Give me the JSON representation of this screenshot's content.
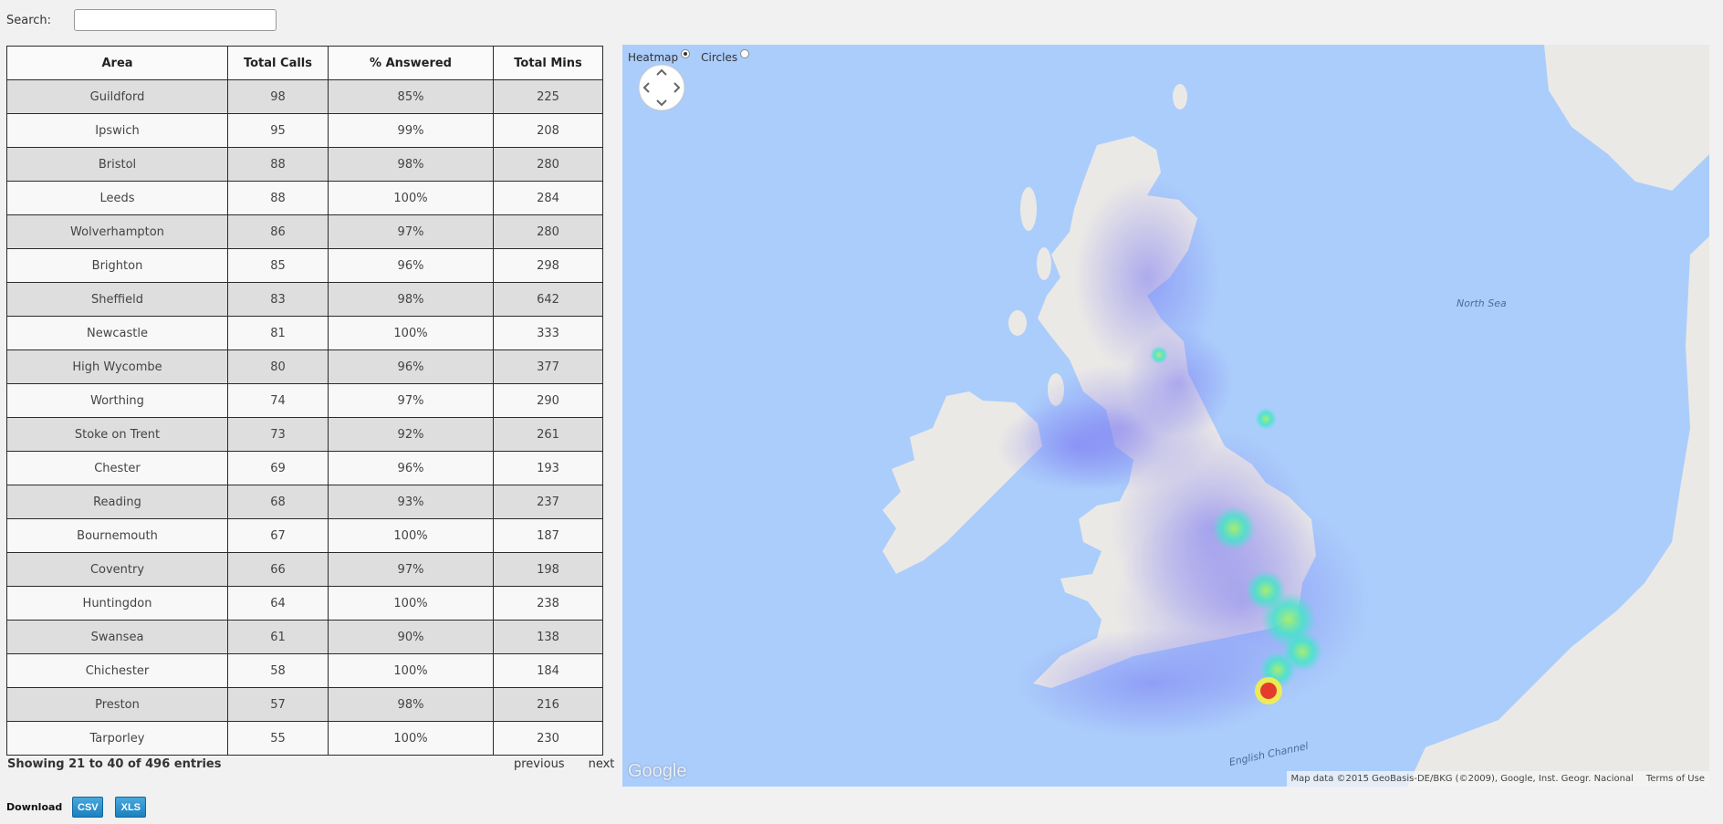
{
  "search": {
    "label": "Search:",
    "value": ""
  },
  "table": {
    "headers": [
      "Area",
      "Total Calls",
      "% Answered",
      "Total Mins"
    ],
    "rows": [
      [
        "Guildford",
        "98",
        "85%",
        "225"
      ],
      [
        "Ipswich",
        "95",
        "99%",
        "208"
      ],
      [
        "Bristol",
        "88",
        "98%",
        "280"
      ],
      [
        "Leeds",
        "88",
        "100%",
        "284"
      ],
      [
        "Wolverhampton",
        "86",
        "97%",
        "280"
      ],
      [
        "Brighton",
        "85",
        "96%",
        "298"
      ],
      [
        "Sheffield",
        "83",
        "98%",
        "642"
      ],
      [
        "Newcastle",
        "81",
        "100%",
        "333"
      ],
      [
        "High Wycombe",
        "80",
        "96%",
        "377"
      ],
      [
        "Worthing",
        "74",
        "97%",
        "290"
      ],
      [
        "Stoke on Trent",
        "73",
        "92%",
        "261"
      ],
      [
        "Chester",
        "69",
        "96%",
        "193"
      ],
      [
        "Reading",
        "68",
        "93%",
        "237"
      ],
      [
        "Bournemouth",
        "67",
        "100%",
        "187"
      ],
      [
        "Coventry",
        "66",
        "97%",
        "198"
      ],
      [
        "Huntingdon",
        "64",
        "100%",
        "238"
      ],
      [
        "Swansea",
        "61",
        "90%",
        "138"
      ],
      [
        "Chichester",
        "58",
        "100%",
        "184"
      ],
      [
        "Preston",
        "57",
        "98%",
        "216"
      ],
      [
        "Tarporley",
        "55",
        "100%",
        "230"
      ]
    ]
  },
  "footer": {
    "info": "Showing 21 to 40 of 496 entries",
    "previous": "previous",
    "next": "next"
  },
  "download": {
    "label": "Download",
    "csv": "CSV",
    "xls": "XLS"
  },
  "map": {
    "heatmap_label": "Heatmap",
    "circles_label": "Circles",
    "selected_mode": "Heatmap",
    "north_sea_label": "North Sea",
    "channel_label": "English Channel",
    "logo": "Google",
    "attribution": "Map data ©2015 GeoBasis-DE/BKG (©2009), Google, Inst. Geogr. Nacional",
    "terms": "Terms of Use",
    "colors": {
      "water": "#abcdfb",
      "land": "#ebe9e6",
      "heat_low": "#7d7cf0",
      "heat_mid": "#3ff0c0",
      "heat_high": "#e53b2f"
    }
  }
}
